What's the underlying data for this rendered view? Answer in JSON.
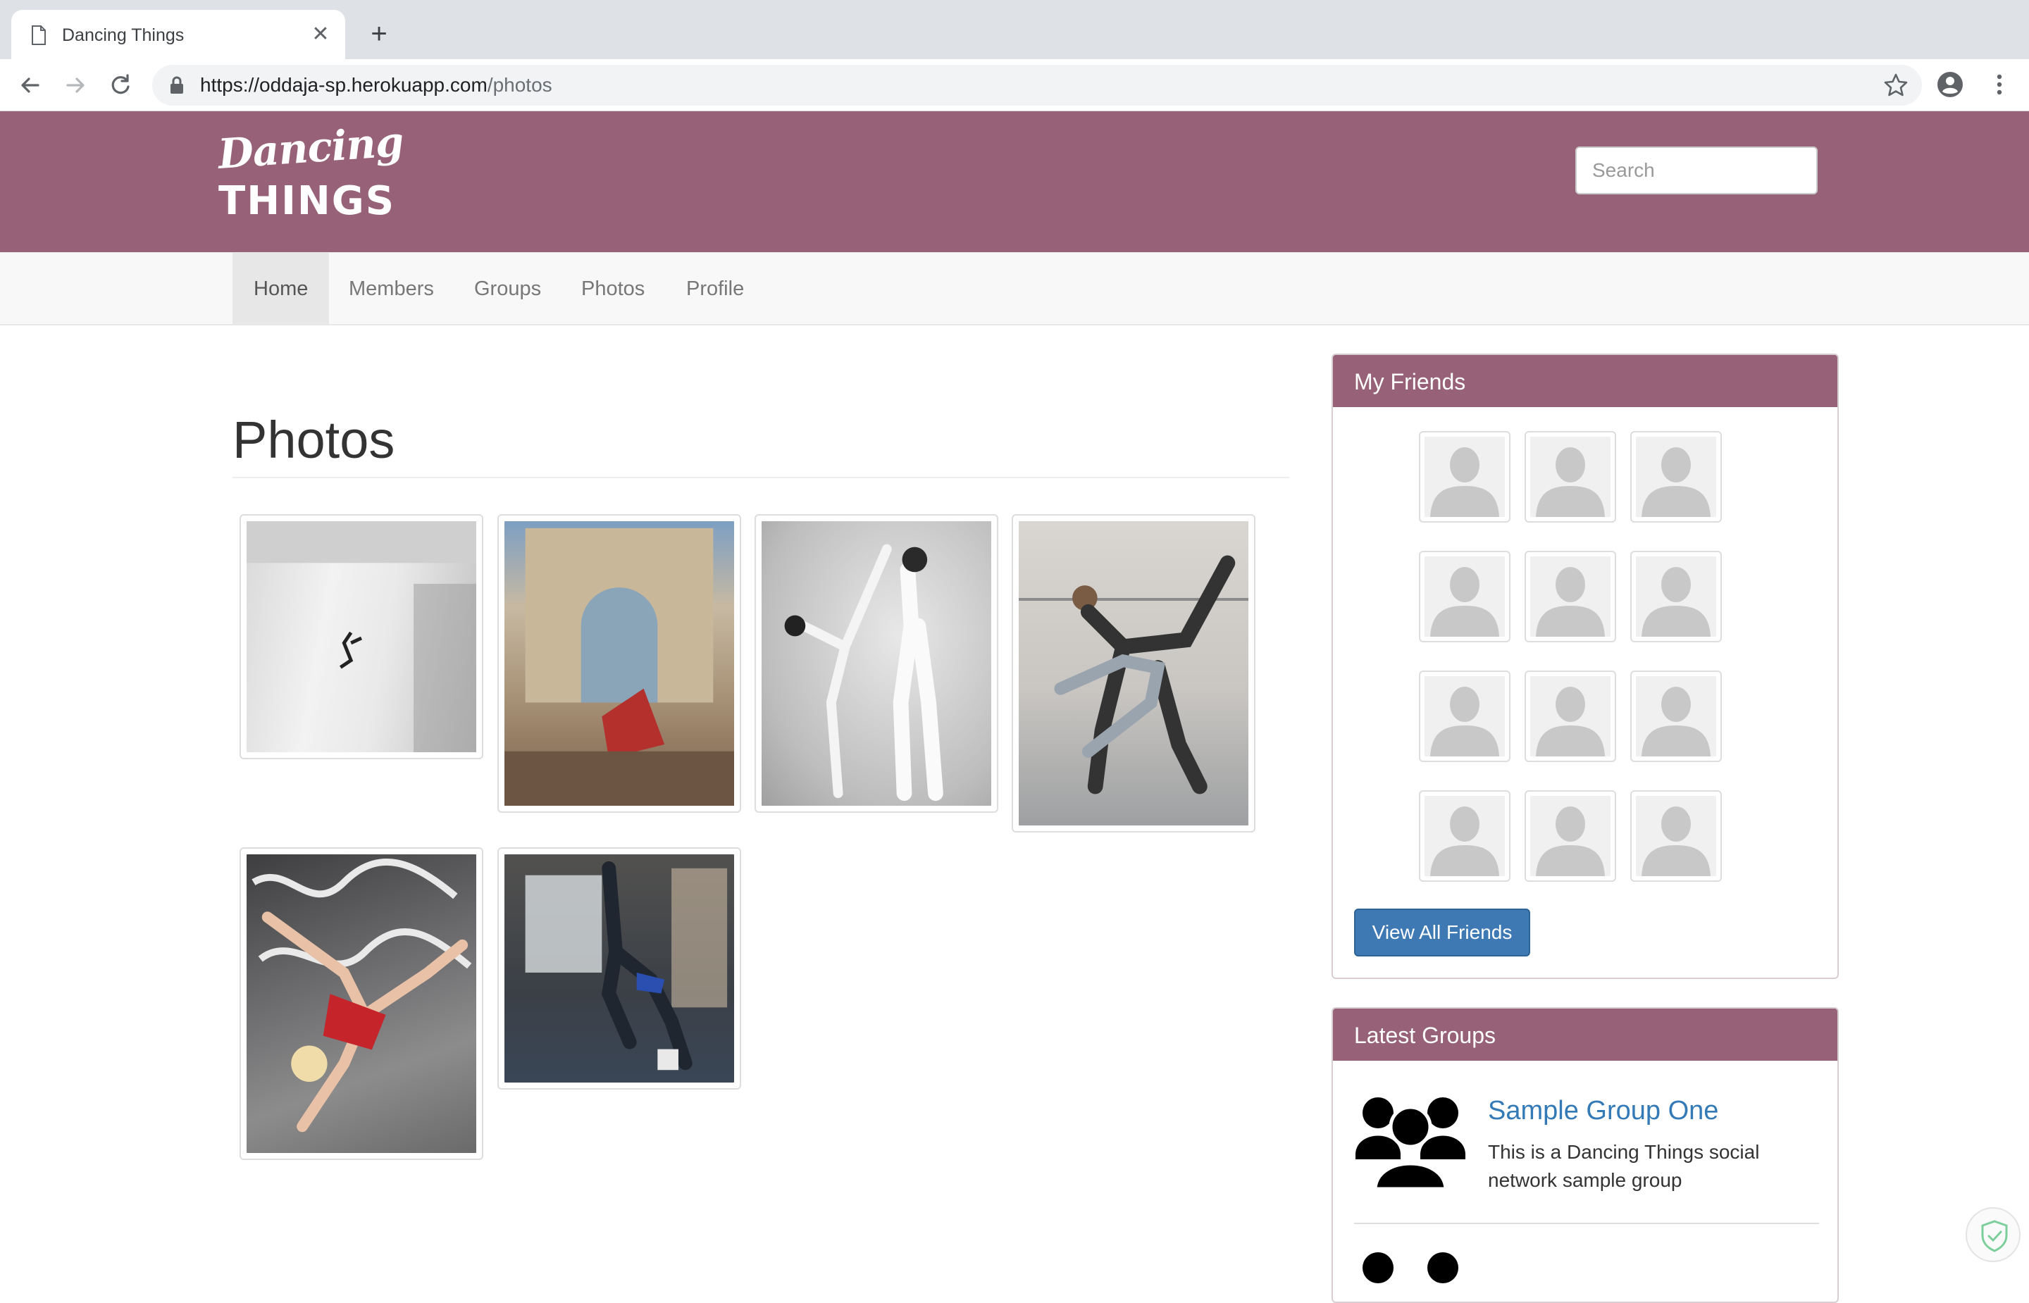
{
  "browser": {
    "tab_title": "Dancing Things",
    "url_host": "https://oddaja-sp.herokuapp.com",
    "url_path": "/photos"
  },
  "site": {
    "logo_line1": "Dancing",
    "logo_line2": "THINGS",
    "search_placeholder": "Search",
    "brand_color": "#976277"
  },
  "nav": {
    "items": [
      {
        "label": "Home",
        "active": true
      },
      {
        "label": "Members",
        "active": false
      },
      {
        "label": "Groups",
        "active": false
      },
      {
        "label": "Photos",
        "active": false
      },
      {
        "label": "Profile",
        "active": false
      }
    ]
  },
  "main": {
    "title": "Photos",
    "photos": [
      {
        "name": "dancer-leaping-white-room"
      },
      {
        "name": "dancer-arc-de-triomphe"
      },
      {
        "name": "ballet-couple-studio"
      },
      {
        "name": "dance-couple-rehearsal"
      },
      {
        "name": "breakdancer-graffiti-wall"
      },
      {
        "name": "breakdancer-warehouse"
      }
    ]
  },
  "sidebar": {
    "friends_title": "My Friends",
    "friends_count": 12,
    "view_all_label": "View All Friends",
    "groups_title": "Latest Groups",
    "groups": [
      {
        "name": "Sample Group One",
        "description": "This is a Dancing Things social network sample group"
      }
    ]
  }
}
